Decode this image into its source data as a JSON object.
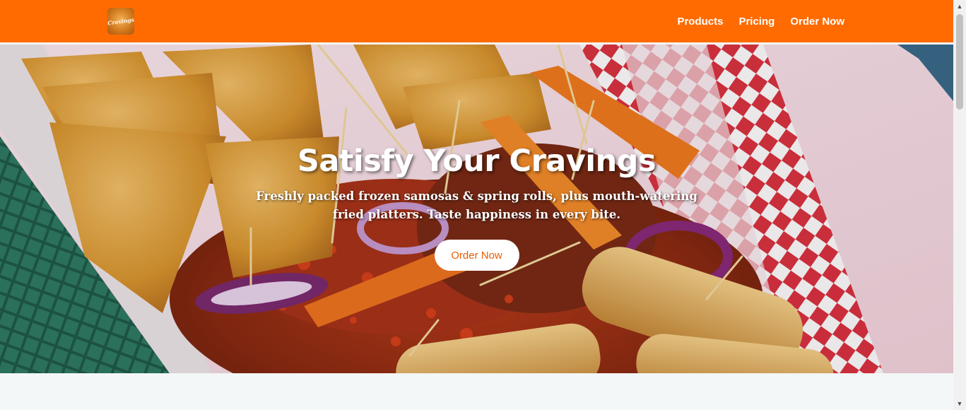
{
  "header": {
    "logo_text": "Cravings",
    "nav": [
      {
        "label": "Products"
      },
      {
        "label": "Pricing"
      },
      {
        "label": "Order Now"
      }
    ]
  },
  "hero": {
    "title": "Satisfy Your Cravings",
    "subtitle": "Freshly packed frozen samosas & spring rolls, plus mouth-watering fried platters. Taste happiness in every bite.",
    "button_label": "Order Now",
    "image_description_icon": "food-platter-image"
  },
  "colors": {
    "brand": "#ff6b00",
    "button_text": "#e85d04"
  },
  "scrollbar": {
    "up_icon": "chevron-up-icon",
    "down_icon": "chevron-down-icon"
  }
}
